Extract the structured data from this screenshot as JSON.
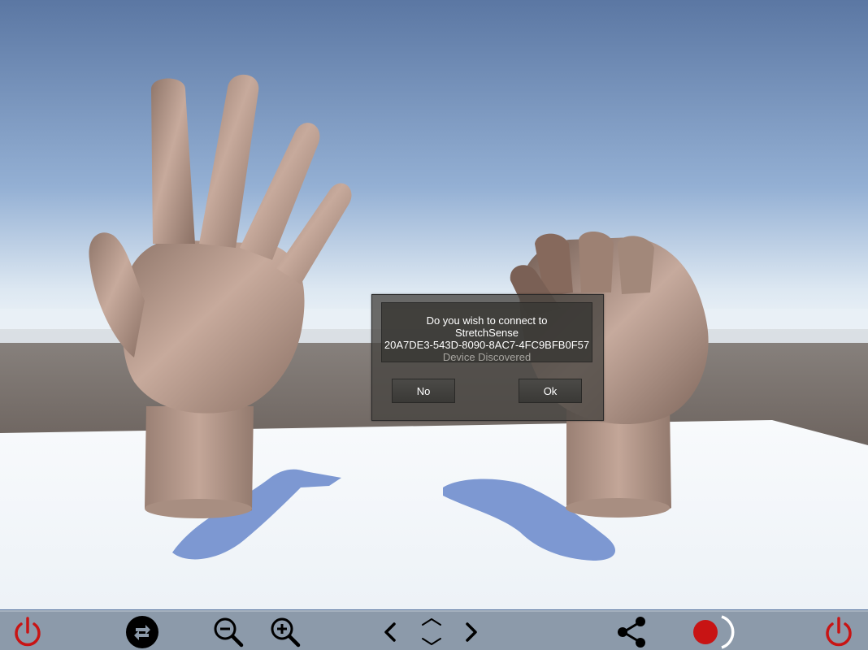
{
  "dialog": {
    "line1": "Do you wish to connect to",
    "line2": "StretchSense",
    "line3": "20A7DE3-543D-8090-8AC7-4FC9BFB0F57",
    "status": "Device Discovered",
    "no_label": "No",
    "ok_label": "Ok"
  },
  "toolbar": {
    "buttons": [
      {
        "icon": "power-icon",
        "color": "#c81414"
      },
      {
        "icon": "swap-icon"
      },
      {
        "icon": "zoom-out-icon"
      },
      {
        "icon": "zoom-in-icon"
      },
      {
        "icon": "chevron-left-icon"
      },
      {
        "icon": "chevron-up-down-icon"
      },
      {
        "icon": "chevron-right-icon"
      },
      {
        "icon": "share-icon"
      },
      {
        "icon": "record-icon",
        "color": "#c81414"
      },
      {
        "icon": "power-icon",
        "color": "#c81414"
      }
    ]
  },
  "colors": {
    "sky_top": "#5f7ba6",
    "horizon": "#eaf1f7",
    "floor": "#f4f7fa",
    "ground": "#6d6560",
    "skin": "#b8998a",
    "shadow": "#7d98d2"
  }
}
